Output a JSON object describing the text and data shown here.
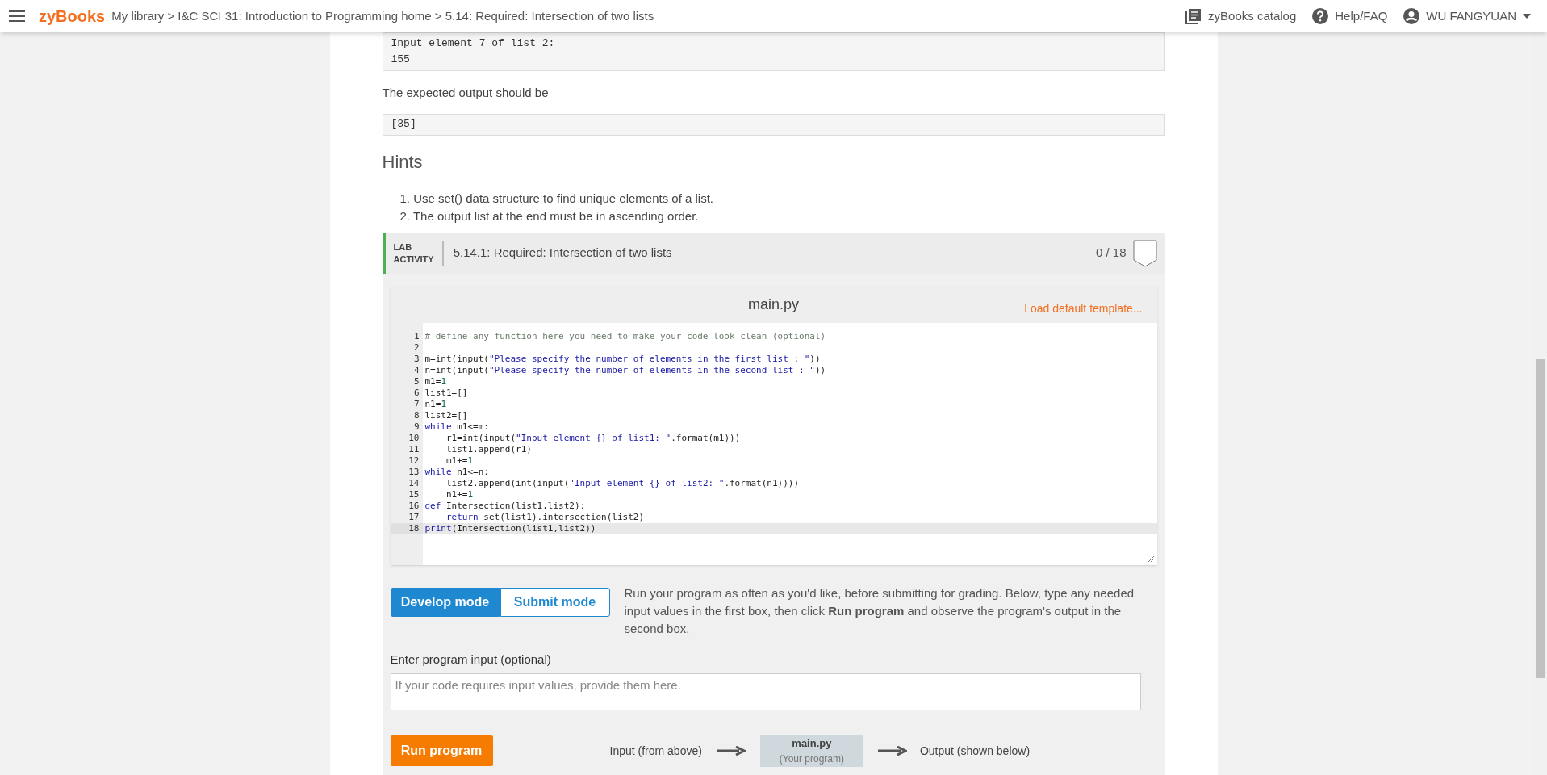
{
  "header": {
    "logo": "zyBooks",
    "breadcrumb": "My library > I&C SCI 31: Introduction to Programming home > 5.14: Required: Intersection of two lists",
    "links": [
      {
        "label": "zyBooks catalog",
        "kind": "catalog"
      },
      {
        "label": "Help/FAQ",
        "kind": "help"
      }
    ],
    "user": "WU FANGYUAN"
  },
  "sample_input": [
    "Input element 7 of list 2:",
    "155"
  ],
  "expected_label": "The expected output should be",
  "expected_output": "[35]",
  "hints": {
    "title": "Hints",
    "items": [
      {
        "number": "1.",
        "text": "Use set() data structure to find unique elements of a list."
      },
      {
        "number": "2.",
        "text": "The output list at the end must be in ascending order."
      }
    ]
  },
  "lab": {
    "badge": [
      "LAB",
      "ACTIVITY"
    ],
    "title": "5.14.1: Required: Intersection of two lists",
    "score": "0 / 18",
    "editor": {
      "filename": "main.py",
      "load_template": "Load default template...",
      "lines": [
        {
          "number": "1",
          "segments": [
            {
              "text": "# define any function here you need to make your code look clean (optional)",
              "kind": "comment"
            }
          ]
        },
        {
          "number": "2"
        },
        {
          "number": "3",
          "segments": [
            {
              "text": "m=int(input(",
              "kind": "plain"
            },
            {
              "text": "\"Please specify the number of elements in the first list : \"",
              "kind": "string"
            },
            {
              "text": "))",
              "kind": "plain"
            }
          ]
        },
        {
          "number": "4",
          "segments": [
            {
              "text": "n=int(input(",
              "kind": "plain"
            },
            {
              "text": "\"Please specify the number of elements in the second list : \"",
              "kind": "string"
            },
            {
              "text": "))",
              "kind": "plain"
            }
          ]
        },
        {
          "number": "5",
          "segments": [
            {
              "text": "m1=",
              "kind": "plain"
            },
            {
              "text": "1",
              "kind": "number"
            }
          ]
        },
        {
          "number": "6",
          "segments": [
            {
              "text": "list1=[]",
              "kind": "plain"
            }
          ]
        },
        {
          "number": "7",
          "segments": [
            {
              "text": "n1=",
              "kind": "plain"
            },
            {
              "text": "1",
              "kind": "number"
            }
          ]
        },
        {
          "number": "8",
          "segments": [
            {
              "text": "list2=[]",
              "kind": "plain"
            }
          ]
        },
        {
          "number": "9",
          "segments": [
            {
              "text": "while",
              "kind": "keyword"
            },
            {
              "text": " m1<=m:",
              "kind": "plain"
            }
          ]
        },
        {
          "number": "10",
          "segments": [
            {
              "text": "    r1=int(input(",
              "kind": "plain"
            },
            {
              "text": "\"Input element {} of list1: \"",
              "kind": "string"
            },
            {
              "text": ".format(m1)))",
              "kind": "plain"
            }
          ]
        },
        {
          "number": "11",
          "segments": [
            {
              "text": "    list1.append(r1)",
              "kind": "plain"
            }
          ]
        },
        {
          "number": "12",
          "segments": [
            {
              "text": "    m1+=",
              "kind": "plain"
            },
            {
              "text": "1",
              "kind": "number"
            }
          ]
        },
        {
          "number": "13",
          "segments": [
            {
              "text": "while",
              "kind": "keyword"
            },
            {
              "text": " n1<=n:",
              "kind": "plain"
            }
          ]
        },
        {
          "number": "14",
          "segments": [
            {
              "text": "    list2.append(int(input(",
              "kind": "plain"
            },
            {
              "text": "\"Input element {} of list2: \"",
              "kind": "string"
            },
            {
              "text": ".format(n1))))",
              "kind": "plain"
            }
          ]
        },
        {
          "number": "15",
          "segments": [
            {
              "text": "    n1+=",
              "kind": "plain"
            },
            {
              "text": "1",
              "kind": "number"
            }
          ]
        },
        {
          "number": "16",
          "segments": [
            {
              "text": "def",
              "kind": "keyword"
            },
            {
              "text": " Intersection(list1,list2):",
              "kind": "plain"
            }
          ]
        },
        {
          "number": "17",
          "segments": [
            {
              "text": "    return",
              "kind": "keyword"
            },
            {
              "text": " set(list1).intersection(list2)",
              "kind": "plain"
            }
          ]
        },
        {
          "number": "18",
          "current": true,
          "segments": [
            {
              "text": "print",
              "kind": "keyword"
            },
            {
              "text": "(Intersection(list1,list2))",
              "kind": "plain"
            }
          ]
        }
      ]
    },
    "modes": [
      {
        "label": "Develop mode",
        "selected": true
      },
      {
        "label": "Submit mode",
        "selected": false
      }
    ],
    "mode_help": "Run your program as often as you'd like, before submitting for grading. Below, type any needed input values in the first box, then click **Run program** and observe the program's output in the second box.",
    "input_label": "Enter program input (optional)",
    "input_placeholder": "If your code requires input values, provide them here.",
    "run_button": "Run program",
    "flow": {
      "input": "Input (from above)",
      "program": "main.py",
      "program_sub": "(Your program)",
      "output": "Output (shown below)"
    }
  }
}
